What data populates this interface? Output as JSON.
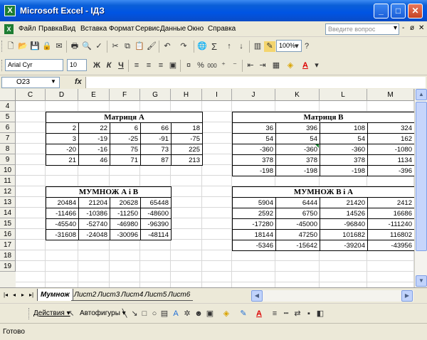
{
  "window": {
    "app_icon": "X",
    "title": "Microsoft Excel - ІДЗ",
    "min": "_",
    "max": "□",
    "close": "✕"
  },
  "menu": {
    "items": [
      "Файл",
      "Правка",
      "Вид",
      "Вставка",
      "Формат",
      "Сервис",
      "Данные",
      "Окно",
      "Справка"
    ],
    "help_placeholder": "Введите вопрос",
    "controls": [
      "▾",
      "-",
      "ø",
      "✕"
    ]
  },
  "toolbar_standard": {
    "zoom": "100%",
    "sigma": "Σ"
  },
  "toolbar_format": {
    "font": "Arial Cyr",
    "size": "10",
    "bold": "Ж",
    "italic": "К",
    "underline": "Ч",
    "percent": "%",
    "thousands": "000"
  },
  "formula_bar": {
    "name_box": "O23",
    "fx": "fx",
    "value": ""
  },
  "columns": [
    "C",
    "D",
    "E",
    "F",
    "G",
    "H",
    "I",
    "J",
    "K",
    "L",
    "M"
  ],
  "rows": [
    "4",
    "5",
    "6",
    "7",
    "8",
    "9",
    "10",
    "11",
    "12",
    "13",
    "14",
    "15",
    "16",
    "17",
    "18",
    "19"
  ],
  "matrix_a": {
    "title": "Матриця А",
    "rows": [
      [
        "2",
        "22",
        "6",
        "66",
        "18"
      ],
      [
        "3",
        "-19",
        "-25",
        "-91",
        "-75"
      ],
      [
        "-20",
        "-16",
        "75",
        "73",
        "225"
      ],
      [
        "21",
        "46",
        "71",
        "87",
        "213"
      ]
    ]
  },
  "matrix_b": {
    "title": "Матриця В",
    "rows": [
      [
        "36",
        "396",
        "108",
        "324"
      ],
      [
        "54",
        "54",
        "54",
        "162"
      ],
      [
        "-360",
        "-360",
        "-360",
        "-1080"
      ],
      [
        "378",
        "378",
        "378",
        "1134"
      ],
      [
        "-198",
        "-198",
        "-198",
        "-396"
      ]
    ]
  },
  "product_ab": {
    "title": "МУМНОЖ А і В",
    "rows": [
      [
        "20484",
        "21204",
        "20628",
        "65448"
      ],
      [
        "-11466",
        "-10386",
        "-11250",
        "-48600"
      ],
      [
        "-45540",
        "-52740",
        "-46980",
        "-96390"
      ],
      [
        "-31608",
        "-24048",
        "-30096",
        "-48114"
      ]
    ]
  },
  "product_ba": {
    "title": "МУМНОЖ В і А",
    "rows": [
      [
        "5904",
        "6444",
        "21420",
        "2412"
      ],
      [
        "2592",
        "6750",
        "14526",
        "16686"
      ],
      [
        "-17280",
        "-45000",
        "-96840",
        "-111240"
      ],
      [
        "18144",
        "47250",
        "101682",
        "116802"
      ],
      [
        "-5346",
        "-15642",
        "-39204",
        "-43956"
      ]
    ]
  },
  "sheet_tabs": [
    "Мумнож",
    "Лист2",
    "Лист3",
    "Лист4",
    "Лист5",
    "Лист6"
  ],
  "active_tab": "Мумнож",
  "draw_toolbar": {
    "actions": "Действия ▾",
    "autoshapes": "Автофигуры ▾"
  },
  "status": "Готово"
}
